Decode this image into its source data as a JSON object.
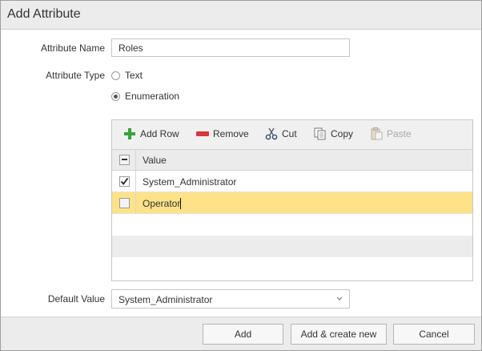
{
  "dialog": {
    "title": "Add Attribute"
  },
  "form": {
    "attribute_name_label": "Attribute Name",
    "attribute_name_value": "Roles",
    "attribute_type_label": "Attribute Type",
    "type_options": [
      {
        "label": "Text",
        "checked": false
      },
      {
        "label": "Enumeration",
        "checked": true
      }
    ],
    "default_value_label": "Default Value",
    "default_value_selected": "System_Administrator"
  },
  "grid": {
    "toolbar": {
      "add_row": "Add Row",
      "remove": "Remove",
      "cut": "Cut",
      "copy": "Copy",
      "paste": "Paste"
    },
    "header": {
      "value": "Value"
    },
    "rows": [
      {
        "value": "System_Administrator",
        "checked": true,
        "selected": false
      },
      {
        "value": "Operator",
        "checked": false,
        "selected": true
      }
    ]
  },
  "footer": {
    "add": "Add",
    "add_create_new": "Add & create new",
    "cancel": "Cancel"
  },
  "colors": {
    "selected_row": "#fde287",
    "add_icon": "#3aa33a",
    "remove_icon": "#d9363e"
  },
  "icons": [
    "plus-icon",
    "minus-icon",
    "scissors-icon",
    "copy-icon",
    "paste-icon",
    "check-icon",
    "chevron-down-icon"
  ]
}
